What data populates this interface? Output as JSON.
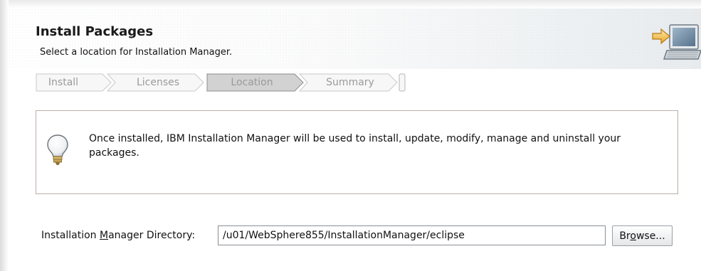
{
  "header": {
    "title": "Install Packages",
    "subtitle": "Select a location for Installation Manager.",
    "icon": "install-computer-icon"
  },
  "wizard": {
    "steps": [
      {
        "label": "Install",
        "active": false
      },
      {
        "label": "Licenses",
        "active": false
      },
      {
        "label": "Location",
        "active": true
      },
      {
        "label": "Summary",
        "active": false
      }
    ]
  },
  "info": {
    "icon": "lightbulb-icon",
    "message": "Once installed, IBM Installation Manager will be used to install, update, modify, manage and uninstall your packages."
  },
  "directory": {
    "label_before": "Installation ",
    "label_mnemonic": "M",
    "label_after": "anager Directory:",
    "value": "/u01/WebSphere855/InstallationManager/eclipse"
  },
  "browse": {
    "label_before": "Br",
    "label_mnemonic": "o",
    "label_after": "wse..."
  },
  "colors": {
    "step_text": "#9a9a9a",
    "step_active_fill": "#d2d2d2",
    "info_border": "#b9aea6"
  }
}
